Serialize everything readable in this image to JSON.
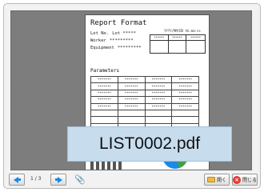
{
  "document": {
    "title": "Report Format",
    "lot_label": "Lot No.",
    "lot_value": "Lot *****",
    "worker_label": "Worker",
    "worker_value": "*********",
    "equipment_label": "Equipment",
    "equipment_value": "*********",
    "date": "YYYY/MM/DD hh:mm:ss",
    "stamp_headers": [
      "******",
      "******",
      "******"
    ],
    "parameters_label": "Parameters",
    "table_cell": "*******"
  },
  "file": {
    "name": "LIST0002.pdf"
  },
  "toolbar": {
    "page_indicator": "1 / 3",
    "open_label": "開く",
    "close_label": "閉じる"
  },
  "colors": {
    "accent": "#1e88e5",
    "banner": "#c7ddee",
    "viewer_bg": "#7d7d7d"
  },
  "icons": [
    "prev-page-icon",
    "next-page-icon",
    "paperclip-icon",
    "folder-icon",
    "close-icon"
  ]
}
